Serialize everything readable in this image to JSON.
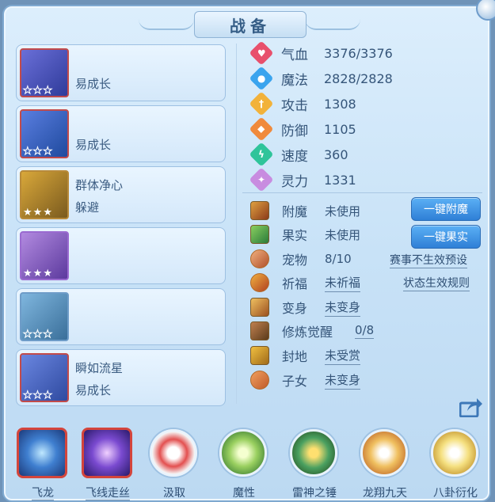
{
  "title": "战备",
  "items": [
    {
      "line1": "",
      "line2": "易成长",
      "stars_filled": 0
    },
    {
      "line1": "",
      "line2": "易成长",
      "stars_filled": 0
    },
    {
      "line1": "群体净心",
      "line2": "躲避",
      "stars_filled": 3
    },
    {
      "line1": "",
      "line2": "",
      "stars_filled": 3
    },
    {
      "line1": "",
      "line2": "",
      "stars_filled": 0
    },
    {
      "line1": "瞬如流星",
      "line2": "易成长",
      "stars_filled": 0
    }
  ],
  "stats": [
    {
      "label": "气血",
      "value": "3376/3376",
      "color": "#e8506c",
      "icon": "heart-icon"
    },
    {
      "label": "魔法",
      "value": "2828/2828",
      "color": "#3aa4ee",
      "icon": "mana-icon"
    },
    {
      "label": "攻击",
      "value": "1308",
      "color": "#f2b23a",
      "icon": "sword-icon"
    },
    {
      "label": "防御",
      "value": "1105",
      "color": "#f08a3c",
      "icon": "shield-icon"
    },
    {
      "label": "速度",
      "value": "360",
      "color": "#2fc49a",
      "icon": "lightning-icon"
    },
    {
      "label": "灵力",
      "value": "1331",
      "color": "#c88ce0",
      "icon": "spirit-icon"
    }
  ],
  "info": [
    {
      "label": "附魔",
      "value": "未使用",
      "underline": false
    },
    {
      "label": "果实",
      "value": "未使用",
      "underline": false
    },
    {
      "label": "宠物",
      "value": "8/10",
      "underline": false
    },
    {
      "label": "祈福",
      "value": "未祈福",
      "underline": true
    },
    {
      "label": "变身",
      "value": "未变身",
      "underline": true
    },
    {
      "label": "修炼觉醒",
      "value": "0/8",
      "underline": true
    },
    {
      "label": "封地",
      "value": "未受赏",
      "underline": true
    },
    {
      "label": "子女",
      "value": "未变身",
      "underline": true
    }
  ],
  "buttons": {
    "enchant": "一键附魔",
    "fruit": "一键果实"
  },
  "links": {
    "event_preset": "赛事不生效预设",
    "status_rules": "状态生效规则"
  },
  "skills": [
    "飞龙",
    "飞线走丝",
    "汲取",
    "魔性",
    "雷神之锤",
    "龙翔九天",
    "八卦衍化"
  ],
  "colors": {
    "accent_button": "#3b8fe3",
    "panel": "#cfe5f8",
    "selected_skill_border": "#d4453c"
  }
}
